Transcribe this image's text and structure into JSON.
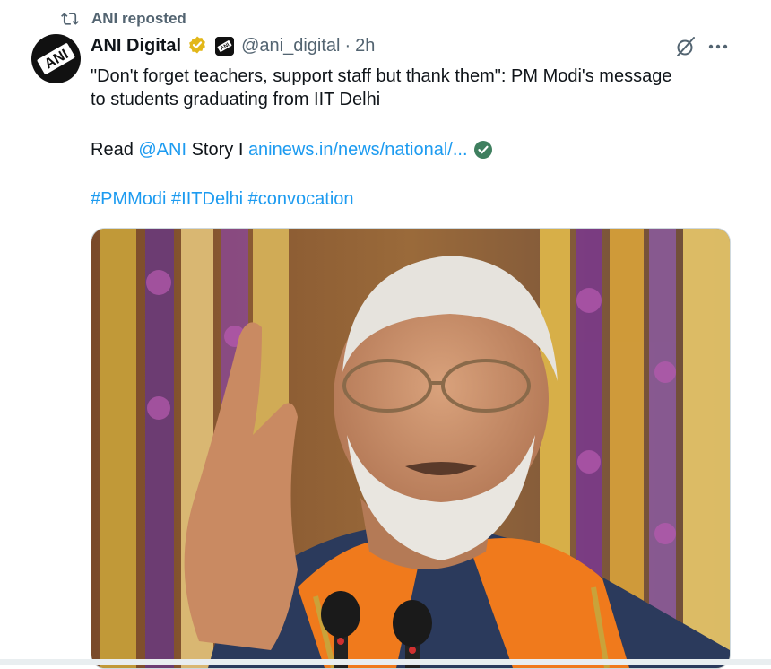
{
  "repost": {
    "text": "ANI reposted",
    "icon": "repost-icon"
  },
  "author": {
    "name": "ANI Digital",
    "handle": "@ani_digital",
    "separator": "·",
    "time": "2h",
    "avatar_text": "ANI",
    "verified": "gold",
    "affiliate_badge_text": "ANI"
  },
  "actions": {
    "grok": "grok-icon",
    "more": "more-icon"
  },
  "post": {
    "line1": "\"Don't forget teachers, support staff but thank them\": PM Modi's message",
    "line2": "to students graduating from IIT Delhi",
    "read_prefix": "Read ",
    "mention": "@ANI",
    "story_text": " Story I ",
    "url": "aninews.in/news/national/...",
    "hashtags": [
      "#PMModi",
      "#IITDelhi",
      "#convocation"
    ]
  },
  "colors": {
    "link": "#1d9bf0",
    "secondary": "#536471",
    "gold": "#e2b719",
    "stole": "#f07a1c",
    "robe": "#2b3a5c"
  }
}
